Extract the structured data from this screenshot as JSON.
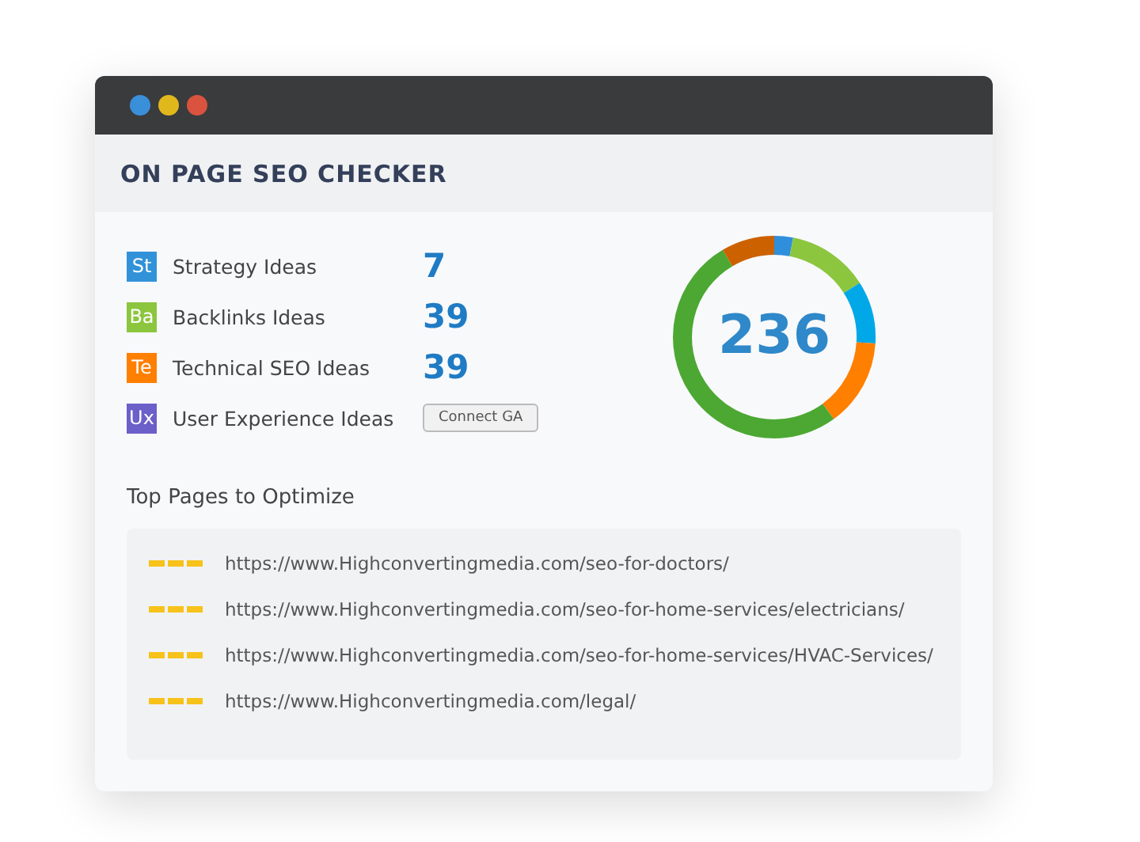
{
  "window": {
    "controls": [
      {
        "color": "#3a8fd9"
      },
      {
        "color": "#e0b81c"
      },
      {
        "color": "#d9533e"
      }
    ],
    "title": "ON PAGE SEO CHECKER"
  },
  "ideas": [
    {
      "badge": "St",
      "color": "#3192d9",
      "label": "Strategy Ideas",
      "kind": "count",
      "value": "7"
    },
    {
      "badge": "Ba",
      "color": "#8cc63e",
      "label": "Backlinks Ideas",
      "kind": "count",
      "value": "39"
    },
    {
      "badge": "Te",
      "color": "#ff7f00",
      "label": "Technical SEO Ideas",
      "kind": "count",
      "value": "39"
    },
    {
      "badge": "Ux",
      "color": "#6b5fc9",
      "label": "User Experience Ideas",
      "kind": "button",
      "value": "Connect GA"
    }
  ],
  "total": "236",
  "top_pages": {
    "title": "Top Pages to Optimize",
    "urls": [
      "https://www.Highconvertingmedia.com/seo-for-doctors/",
      "https://www.Highconvertingmedia.com/seo-for-home-services/electricians/",
      "https://www.Highconvertingmedia.com/seo-for-home-services/HVAC-Services/",
      "https://www.Highconvertingmedia.com/legal/"
    ]
  }
}
